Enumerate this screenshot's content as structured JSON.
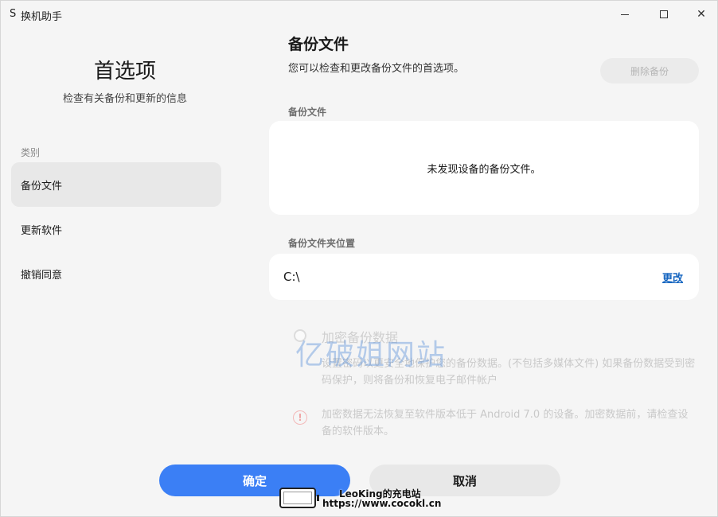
{
  "window": {
    "logo": "S",
    "title": "换机助手",
    "controls": {
      "minimize": "minimize",
      "maximize": "maximize",
      "close": "✕"
    }
  },
  "sidebar": {
    "title": "首选项",
    "subtitle": "检查有关备份和更新的信息",
    "category_label": "类别",
    "items": [
      {
        "label": "备份文件",
        "active": true
      },
      {
        "label": "更新软件",
        "active": false
      },
      {
        "label": "撤销同意",
        "active": false
      }
    ]
  },
  "main": {
    "title": "备份文件",
    "description": "您可以检查和更改备份文件的首选项。",
    "delete_button": "删除备份",
    "backup_files_label": "备份文件",
    "empty_message": "未发现设备的备份文件。",
    "folder_label": "备份文件夹位置",
    "folder_path": "C:\\",
    "change_link": "更改",
    "encrypt": {
      "title": "加密备份数据",
      "description": "设置密码以更安全地保护您的备份数据。(不包括多媒体文件) 如果备份数据受到密码保护，则将备份和恢复电子邮件帐户",
      "warning_icon": "!",
      "warning": "加密数据无法恢复至软件版本低于 Android 7.0 的设备。加密数据前，请检查设备的软件版本。"
    }
  },
  "footer": {
    "confirm": "确定",
    "cancel": "取消"
  },
  "watermark": "亿破姐网站",
  "badge": {
    "line1": "LeoKing的充电站",
    "line2": "https://www.cocokl.cn"
  },
  "colors": {
    "accent": "#3b7ff5",
    "link": "#1565c0",
    "background": "#f5f5f5"
  }
}
